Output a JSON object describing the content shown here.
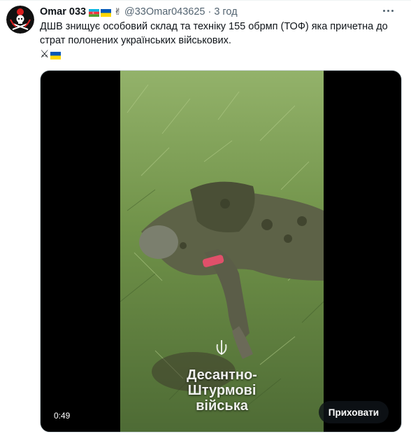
{
  "tweet": {
    "author_name": "Omar 033",
    "handle": "@33Omar043625",
    "separator": "·",
    "time": "3 год",
    "text": "ДШВ знищує особовий склад та техніку 155 обрмп (ТОФ) яка причетна до страт полонених українських військових.",
    "author_flags": [
      "azerbaijan-flag",
      "ukraine-flag"
    ],
    "emoji_line": [
      "crossed-swords-icon",
      "ukraine-flag"
    ]
  },
  "media": {
    "duration": "0:49",
    "hide_label": "Приховати",
    "watermark_lines": [
      "Десантно-",
      "Штурмові",
      "війська"
    ]
  },
  "colors": {
    "text_primary": "#0f1419",
    "text_secondary": "#536471",
    "border": "#cfd9de",
    "ukraine_blue": "#0057b7",
    "ukraine_yellow": "#ffd700"
  }
}
